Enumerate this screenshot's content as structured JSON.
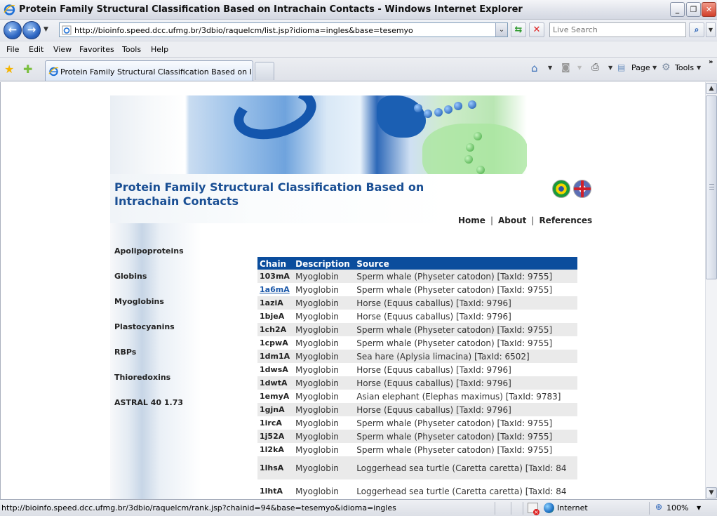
{
  "window": {
    "title": "Protein Family Structural Classification Based on Intrachain Contacts - Windows Internet Explorer",
    "min_label": "_",
    "restore_label": "❐",
    "close_label": "✕"
  },
  "address_bar": {
    "url": "http://bioinfo.speed.dcc.ufmg.br/3dbio/raquelcm/list.jsp?idioma=ingles&base=tesemyo",
    "search_placeholder": "Live Search"
  },
  "menu": [
    "File",
    "Edit",
    "View",
    "Favorites",
    "Tools",
    "Help"
  ],
  "tabs": {
    "active_label": "Protein Family Structural Classification Based on Intra..."
  },
  "command_bar": {
    "page_label": "Page",
    "tools_label": "Tools",
    "more_label": "»"
  },
  "site": {
    "title": "Protein Family Structural Classification Based on Intrachain Contacts",
    "nav": [
      "Home",
      "About",
      "References"
    ],
    "nav_separator": "|",
    "languages": [
      "Portuguese (Brazil)",
      "English"
    ],
    "sidebar": [
      "Apolipoproteins",
      "Globins",
      "Myoglobins",
      "Plastocyanins",
      "RBPs",
      "Thioredoxins",
      "ASTRAL 40 1.73"
    ]
  },
  "table": {
    "headers": [
      "Chain",
      "Description",
      "Source"
    ],
    "rows": [
      {
        "chain": "103mA",
        "desc": "Myoglobin",
        "source": "Sperm whale (Physeter catodon) [TaxId: 9755]"
      },
      {
        "chain": "1a6mA",
        "desc": "Myoglobin",
        "source": "Sperm whale (Physeter catodon) [TaxId: 9755]",
        "link": true
      },
      {
        "chain": "1aziA",
        "desc": "Myoglobin",
        "source": "Horse (Equus caballus) [TaxId: 9796]"
      },
      {
        "chain": "1bjeA",
        "desc": "Myoglobin",
        "source": "Horse (Equus caballus) [TaxId: 9796]"
      },
      {
        "chain": "1ch2A",
        "desc": "Myoglobin",
        "source": "Sperm whale (Physeter catodon) [TaxId: 9755]"
      },
      {
        "chain": "1cpwA",
        "desc": "Myoglobin",
        "source": "Sperm whale (Physeter catodon) [TaxId: 9755]"
      },
      {
        "chain": "1dm1A",
        "desc": "Myoglobin",
        "source": "Sea hare (Aplysia limacina) [TaxId: 6502]"
      },
      {
        "chain": "1dwsA",
        "desc": "Myoglobin",
        "source": "Horse (Equus caballus) [TaxId: 9796]"
      },
      {
        "chain": "1dwtA",
        "desc": "Myoglobin",
        "source": "Horse (Equus caballus) [TaxId: 9796]"
      },
      {
        "chain": "1emyA",
        "desc": "Myoglobin",
        "source": "Asian elephant (Elephas maximus) [TaxId: 9783]"
      },
      {
        "chain": "1gjnA",
        "desc": "Myoglobin",
        "source": "Horse (Equus caballus) [TaxId: 9796]"
      },
      {
        "chain": "1ircA",
        "desc": "Myoglobin",
        "source": "Sperm whale (Physeter catodon) [TaxId: 9755]"
      },
      {
        "chain": "1j52A",
        "desc": "Myoglobin",
        "source": "Sperm whale (Physeter catodon) [TaxId: 9755]"
      },
      {
        "chain": "1l2kA",
        "desc": "Myoglobin",
        "source": "Sperm whale (Physeter catodon) [TaxId: 9755]"
      },
      {
        "chain": "1lhsA",
        "desc": "Myoglobin",
        "source": "Loggerhead sea turtle (Caretta caretta) [TaxId: 84"
      },
      {
        "chain": "1lhtA",
        "desc": "Myoglobin",
        "source": "Loggerhead sea turtle (Caretta caretta) [TaxId: 84"
      }
    ]
  },
  "status_bar": {
    "text": "http://bioinfo.speed.dcc.ufmg.br/3dbio/raquelcm/rank.jsp?chainid=94&base=tesemyo&idioma=ingles",
    "zone": "Internet",
    "zoom": "100%"
  },
  "colors": {
    "header_bg": "#0b4d9d",
    "title_color": "#1a4f94",
    "link_color": "#1a57a8",
    "alt_row": "#eaeaea"
  }
}
